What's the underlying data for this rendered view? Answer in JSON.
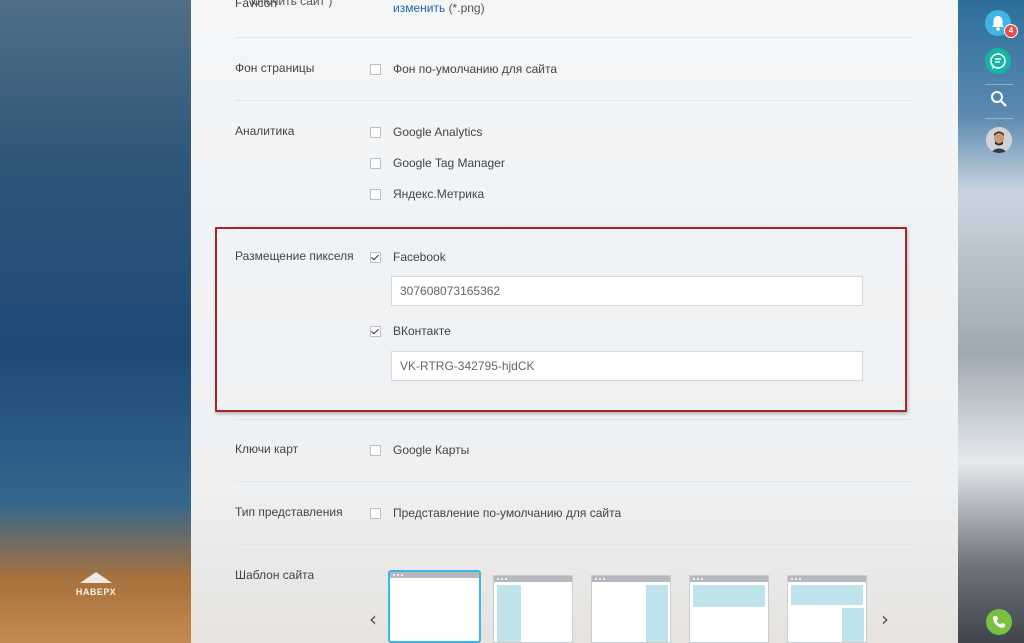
{
  "scroll_up": {
    "label": "НАВЕРХ"
  },
  "favicon": {
    "label": "Favicon",
    "overlay_text": "ключить сайт )",
    "link": "изменить",
    "suffix": "(*.png)"
  },
  "rows": {
    "background": {
      "label": "Фон страницы",
      "options": [
        {
          "label": "Фон по-умолчанию для сайта",
          "checked": false
        }
      ]
    },
    "analytics": {
      "label": "Аналитика",
      "options": [
        {
          "label": "Google Analytics",
          "checked": false
        },
        {
          "label": "Google Tag Manager",
          "checked": false
        },
        {
          "label": "Яндекс.Метрика",
          "checked": false
        }
      ]
    },
    "pixel": {
      "label": "Размещение пикселя",
      "facebook": {
        "label": "Facebook",
        "checked": true,
        "value": "307608073165362"
      },
      "vk": {
        "label": "ВКонтакте",
        "checked": true,
        "value": "VK-RTRG-342795-hjdCK"
      }
    },
    "maps": {
      "label": "Ключи карт",
      "options": [
        {
          "label": "Google Карты",
          "checked": false
        }
      ]
    },
    "view": {
      "label": "Тип представления",
      "options": [
        {
          "label": "Представление по-умолчанию для сайта",
          "checked": false
        }
      ]
    },
    "template": {
      "label": "Шаблон сайта",
      "selected_index": 0
    }
  },
  "sidebar": {
    "notifications_count": "4"
  },
  "colors": {
    "accent": "#3fb4e7",
    "highlight": "#a3262c",
    "link": "#2067b0",
    "badge": "#e54d42",
    "chat": "#16b5a4",
    "phone": "#7ac143"
  }
}
